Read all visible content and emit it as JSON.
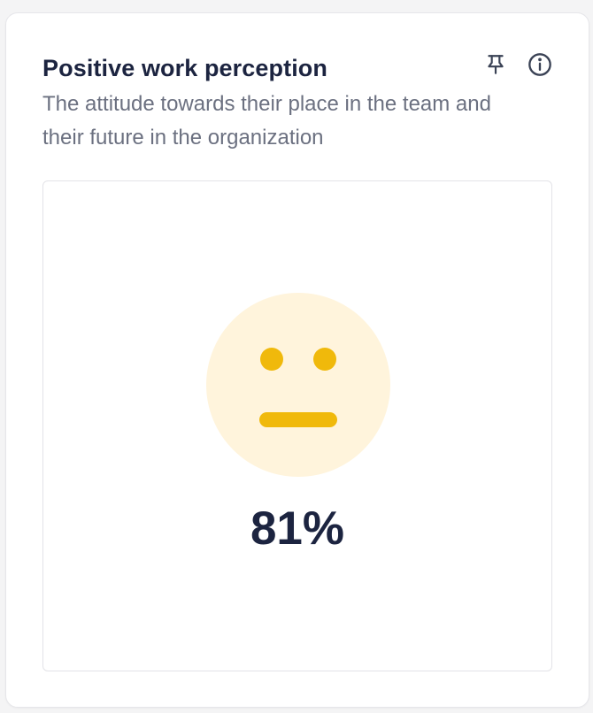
{
  "card": {
    "title": "Positive work perception",
    "subtitle": "The attitude towards their place in the team and their future in the organization",
    "icons": {
      "pin": "pin-icon",
      "info": "info-icon"
    }
  },
  "metric": {
    "value": "81%",
    "face_icon": "neutral-face-icon",
    "colors": {
      "face_background": "#fff4dc",
      "face_features": "#f0b90b",
      "text": "#1c2440",
      "icon": "#3a4255"
    }
  }
}
